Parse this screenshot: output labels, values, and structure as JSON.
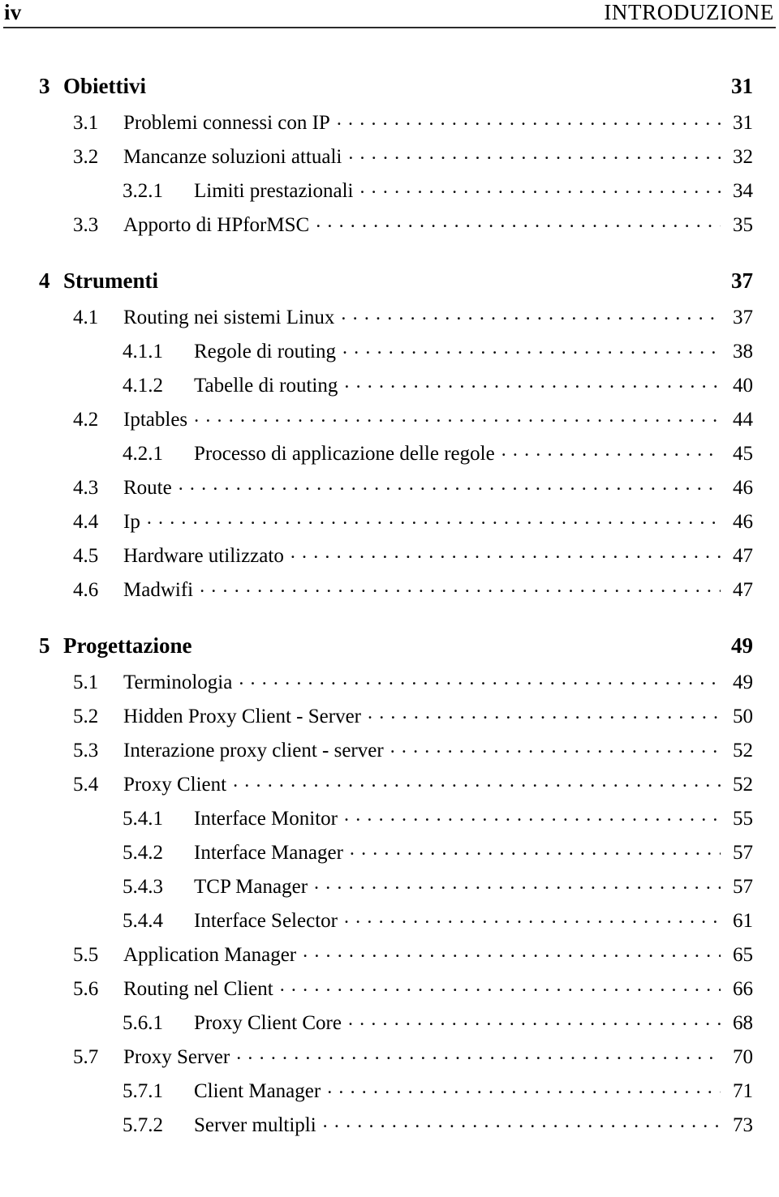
{
  "header": {
    "folio": "iv",
    "title": "INTRODUZIONE"
  },
  "toc": {
    "entries": [
      {
        "level": "chapter",
        "number": "3",
        "label": "Obiettivi",
        "page": "31",
        "spaced_above": false
      },
      {
        "level": "section",
        "number": "3.1",
        "label": "Problemi connessi con IP",
        "page": "31",
        "spaced_above": false
      },
      {
        "level": "section",
        "number": "3.2",
        "label": "Mancanze soluzioni attuali",
        "page": "32",
        "spaced_above": false
      },
      {
        "level": "subsection",
        "number": "3.2.1",
        "label": "Limiti prestazionali",
        "page": "34",
        "spaced_above": false
      },
      {
        "level": "section",
        "number": "3.3",
        "label": "Apporto di HPforMSC",
        "page": "35",
        "spaced_above": false
      },
      {
        "level": "chapter",
        "number": "4",
        "label": "Strumenti",
        "page": "37",
        "spaced_above": true
      },
      {
        "level": "section",
        "number": "4.1",
        "label": "Routing nei sistemi Linux",
        "page": "37",
        "spaced_above": false
      },
      {
        "level": "subsection",
        "number": "4.1.1",
        "label": "Regole di routing",
        "page": "38",
        "spaced_above": false
      },
      {
        "level": "subsection",
        "number": "4.1.2",
        "label": "Tabelle di routing",
        "page": "40",
        "spaced_above": false
      },
      {
        "level": "section",
        "number": "4.2",
        "label": "Iptables",
        "page": "44",
        "spaced_above": false
      },
      {
        "level": "subsection",
        "number": "4.2.1",
        "label": "Processo di applicazione delle regole",
        "page": "45",
        "spaced_above": false
      },
      {
        "level": "section",
        "number": "4.3",
        "label": "Route",
        "page": "46",
        "spaced_above": false
      },
      {
        "level": "section",
        "number": "4.4",
        "label": "Ip",
        "page": "46",
        "spaced_above": false
      },
      {
        "level": "section",
        "number": "4.5",
        "label": "Hardware utilizzato",
        "page": "47",
        "spaced_above": false
      },
      {
        "level": "section",
        "number": "4.6",
        "label": "Madwifi",
        "page": "47",
        "spaced_above": false
      },
      {
        "level": "chapter",
        "number": "5",
        "label": "Progettazione",
        "page": "49",
        "spaced_above": true
      },
      {
        "level": "section",
        "number": "5.1",
        "label": "Terminologia",
        "page": "49",
        "spaced_above": false
      },
      {
        "level": "section",
        "number": "5.2",
        "label": "Hidden Proxy Client - Server",
        "page": "50",
        "spaced_above": false
      },
      {
        "level": "section",
        "number": "5.3",
        "label": "Interazione proxy client - server",
        "page": "52",
        "spaced_above": false
      },
      {
        "level": "section",
        "number": "5.4",
        "label": "Proxy Client",
        "page": "52",
        "spaced_above": false
      },
      {
        "level": "subsection",
        "number": "5.4.1",
        "label": "Interface Monitor",
        "page": "55",
        "spaced_above": false
      },
      {
        "level": "subsection",
        "number": "5.4.2",
        "label": "Interface Manager",
        "page": "57",
        "spaced_above": false
      },
      {
        "level": "subsection",
        "number": "5.4.3",
        "label": "TCP Manager",
        "page": "57",
        "spaced_above": false
      },
      {
        "level": "subsection",
        "number": "5.4.4",
        "label": "Interface Selector",
        "page": "61",
        "spaced_above": false
      },
      {
        "level": "section",
        "number": "5.5",
        "label": "Application Manager",
        "page": "65",
        "spaced_above": false
      },
      {
        "level": "section",
        "number": "5.6",
        "label": "Routing nel Client",
        "page": "66",
        "spaced_above": false
      },
      {
        "level": "subsection",
        "number": "5.6.1",
        "label": "Proxy Client Core",
        "page": "68",
        "spaced_above": false
      },
      {
        "level": "section",
        "number": "5.7",
        "label": "Proxy Server",
        "page": "70",
        "spaced_above": false
      },
      {
        "level": "subsection",
        "number": "5.7.1",
        "label": "Client Manager",
        "page": "71",
        "spaced_above": false
      },
      {
        "level": "subsection",
        "number": "5.7.2",
        "label": "Server multipli",
        "page": "73",
        "spaced_above": false
      }
    ]
  }
}
